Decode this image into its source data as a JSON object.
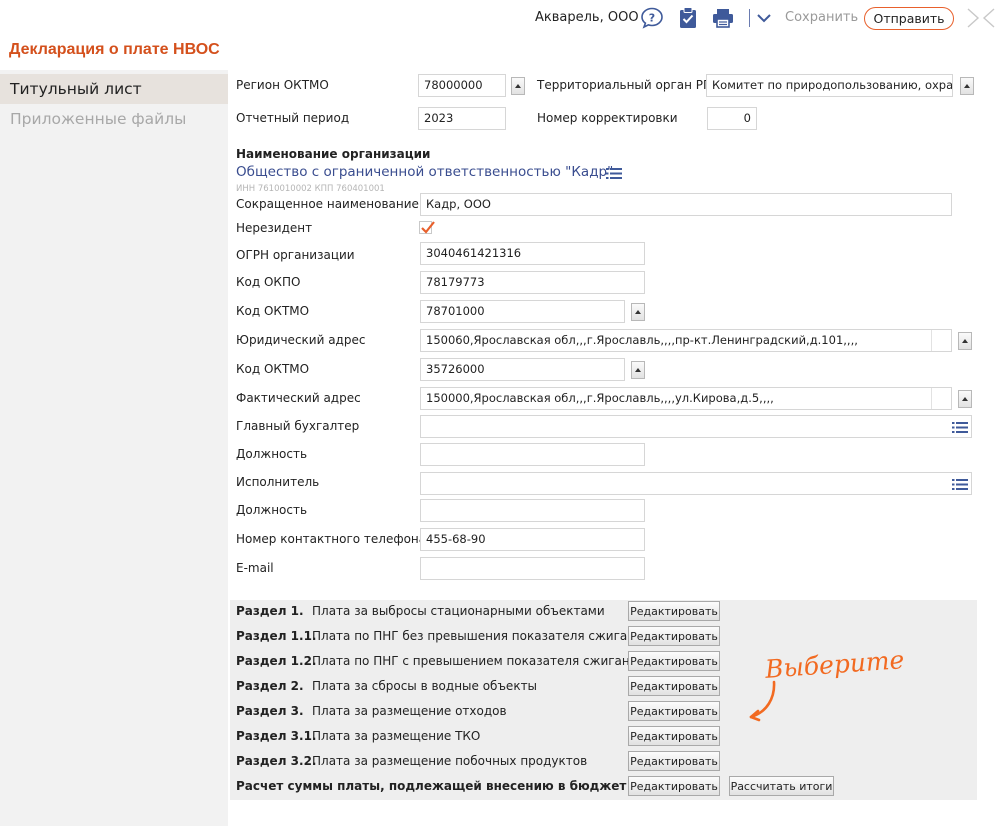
{
  "header": {
    "org_name": "Акварель, ООО",
    "save_label": "Сохранить",
    "send_label": "Отправить",
    "icons": [
      "help-icon",
      "clipboard-check-icon",
      "printer-icon",
      "chevron-down-icon",
      "close-icon"
    ]
  },
  "page_title": "Декларация о плате НВОС",
  "sidebar": {
    "items": [
      {
        "label": "Титульный лист",
        "active": true
      },
      {
        "label": "Приложенные файлы",
        "active": false
      }
    ]
  },
  "form": {
    "region_label": "Регион ОКТМО",
    "region_value": "78000000",
    "terr_label": "Территориальный орган РПН",
    "terr_value": "Комитет по природопользованию, охран…",
    "period_label": "Отчетный период",
    "period_value": "2023",
    "corr_label": "Номер корректировки",
    "corr_value": "0",
    "org_section_heading": "Наименование организации",
    "org_full_name": "Общество с ограниченной ответственностью \"Кадр\"",
    "inn_kpp": "ИНН 7610010002 КПП 760401001",
    "short_name_label": "Сокращенное наименование",
    "short_name_value": "Кадр, ООО",
    "nonresident_label": "Нерезидент",
    "nonresident_checked": true,
    "ogrn_label": "ОГРН организации",
    "ogrn_value": "3040461421316",
    "okpo_label": "Код ОКПО",
    "okpo_value": "78179773",
    "oktmo1_label": "Код ОКТМО",
    "oktmo1_value": "78701000",
    "legal_addr_label": "Юридический адрес",
    "legal_addr_value": "150060,Ярославская обл,,,г.Ярославль,,,,пр-кт.Ленинградский,д.101,,,,",
    "oktmo2_label": "Код ОКТМО",
    "oktmo2_value": "35726000",
    "fact_addr_label": "Фактический адрес",
    "fact_addr_value": "150000,Ярославская обл,,,г.Ярославль,,,,ул.Кирова,д.5,,,,",
    "chief_acc_label": "Главный бухгалтер",
    "chief_acc_value": "",
    "position1_label": "Должность",
    "position1_value": "",
    "executor_label": "Исполнитель",
    "executor_value": "",
    "position2_label": "Должность",
    "position2_value": "",
    "phone_label": "Номер контактного телефона",
    "phone_value": "455-68-90",
    "email_label": "E-mail",
    "email_value": ""
  },
  "sections": [
    {
      "label": "Раздел 1.",
      "desc": "Плата за выбросы стационарными объектами",
      "button": "Редактировать"
    },
    {
      "label": "Раздел 1.1.",
      "desc": "Плата по ПНГ без превышения показателя сжигания",
      "button": "Редактировать"
    },
    {
      "label": "Раздел 1.2.",
      "desc": "Плата по ПНГ с превышением показателя сжигания",
      "button": "Редактировать"
    },
    {
      "label": "Раздел 2.",
      "desc": "Плата за сбросы в водные объекты",
      "button": "Редактировать"
    },
    {
      "label": "Раздел 3.",
      "desc": "Плата за размещение отходов",
      "button": "Редактировать"
    },
    {
      "label": "Раздел 3.1.",
      "desc": "Плата за размещение ТКО",
      "button": "Редактировать"
    },
    {
      "label": "Раздел 3.2.",
      "desc": "Плата за размещение побочных продуктов",
      "button": "Редактировать"
    }
  ],
  "total": {
    "label": "Расчет суммы платы, подлежащей внесению в бюджет",
    "edit_button": "Редактировать",
    "calc_button": "Рассчитать итоги"
  },
  "annotation": {
    "text": "Выберите",
    "color": "#f26a21"
  },
  "colors": {
    "accent": "#d4501c",
    "link": "#3a4d8f",
    "icon": "#3f5a9a"
  }
}
